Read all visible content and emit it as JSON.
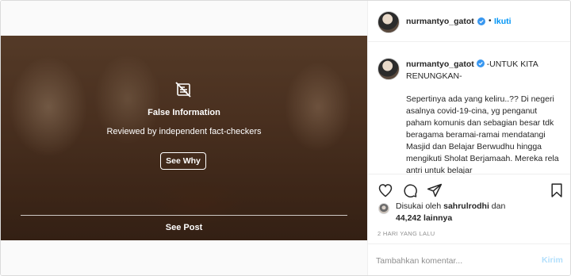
{
  "colors": {
    "accent": "#0095f6",
    "post_disabled": "#b2dffc",
    "text_primary": "#262626",
    "text_secondary": "#8e8e8e",
    "border": "#dbdbdb"
  },
  "media": {
    "fact_check_icon": "false-information-icon",
    "title": "False Information",
    "subtitle": "Reviewed by independent fact-checkers",
    "see_why_label": "See Why",
    "see_post_label": "See Post"
  },
  "header": {
    "username": "nurmantyo_gatot",
    "verified_icon": "verified-badge-icon",
    "separator": "•",
    "follow_label": "Ikuti"
  },
  "caption": {
    "username": "nurmantyo_gatot",
    "title": "-UNTUK KITA RENUNGKAN-",
    "body": "Sepertinya ada yang keliru..?? Di negeri asalnya covid-19-cina, yg penganut paham komunis dan sebagian besar tdk beragama beramai-ramai mendatangi Masjid dan Belajar Berwudhu hingga mengikuti Sholat Berjamaah. Mereka rela antri untuk belajar"
  },
  "actions": {
    "like_icon": "heart-icon",
    "comment_icon": "comment-icon",
    "share_icon": "share-icon",
    "save_icon": "bookmark-icon"
  },
  "likes": {
    "prefix": "Disukai oleh ",
    "user": "sahrulrodhi",
    "middle": " dan",
    "count": "44,242",
    "suffix": " lainnya"
  },
  "timestamp": "2 HARI YANG LALU",
  "comment": {
    "placeholder": "Tambahkan komentar...",
    "post_label": "Kirim"
  }
}
